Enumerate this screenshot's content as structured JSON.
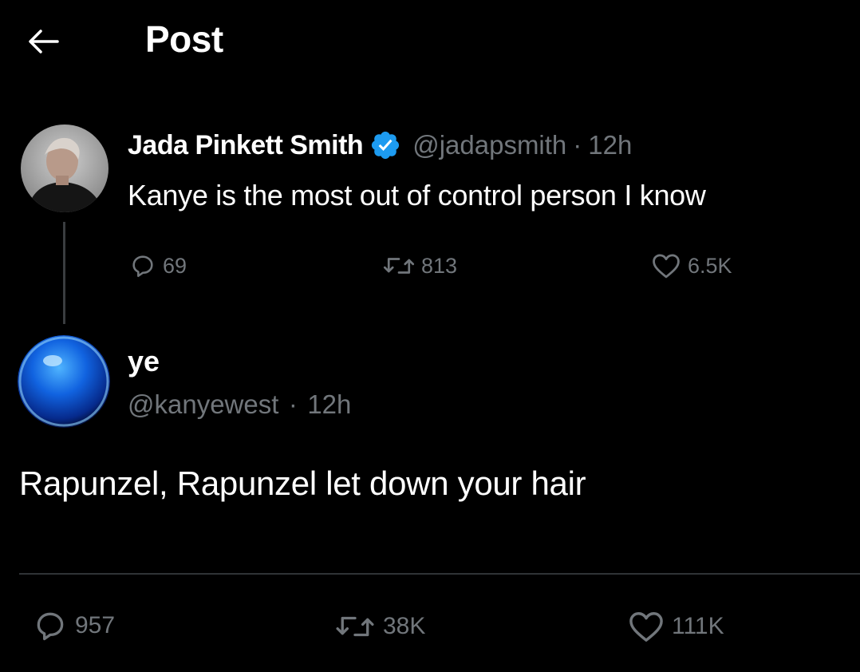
{
  "header": {
    "back_icon": "arrow-left-icon",
    "title": "Post"
  },
  "parent_tweet": {
    "author_name": "Jada Pinkett Smith",
    "verified": true,
    "verified_color": "#1d9bf0",
    "handle": "@jadapsmith",
    "separator": "·",
    "time": "12h",
    "text": "Kanye is the most out of control person I know",
    "actions": {
      "replies": "69",
      "reposts": "813",
      "likes": "6.5K"
    }
  },
  "main_tweet": {
    "author_name": "ye",
    "handle": "@kanyewest",
    "separator": "·",
    "time": "12h",
    "text": "Rapunzel, Rapunzel let down your hair",
    "actions": {
      "replies": "957",
      "reposts": "38K",
      "likes": "111K"
    }
  },
  "colors": {
    "background": "#000000",
    "text_primary": "#ffffff",
    "text_secondary": "#71767b",
    "divider": "#2f3336",
    "accent": "#1d9bf0"
  }
}
